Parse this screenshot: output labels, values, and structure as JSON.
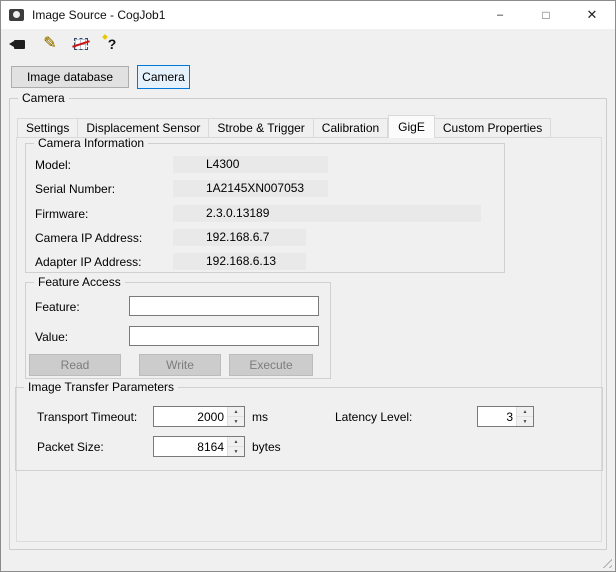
{
  "window": {
    "title": "Image Source - CogJob1",
    "controls": {
      "minimize": "–",
      "maximize": "□",
      "close": "✕"
    }
  },
  "toolbar": {
    "icons": [
      {
        "name": "camera-icon"
      },
      {
        "name": "pencil-setup-icon"
      },
      {
        "name": "live-display-grid-icon"
      },
      {
        "name": "help-icon",
        "glyph": "?"
      }
    ]
  },
  "source_buttons": {
    "image_database": "Image database",
    "camera": "Camera"
  },
  "camera_group": {
    "label": "Camera"
  },
  "tabs": [
    "Settings",
    "Displacement Sensor",
    "Strobe & Trigger",
    "Calibration",
    "GigE",
    "Custom Properties"
  ],
  "camera_information": {
    "label": "Camera Information",
    "fields": [
      {
        "label": "Model:",
        "value": "L4300"
      },
      {
        "label": "Serial Number:",
        "value": "1A2145XN007053"
      },
      {
        "label": "Firmware:",
        "value": "2.3.0.13189"
      },
      {
        "label": "Camera IP Address:",
        "value": "192.168.6.7"
      },
      {
        "label": "Adapter IP Address:",
        "value": "192.168.6.13"
      }
    ]
  },
  "feature_access": {
    "label": "Feature Access",
    "feature_label": "Feature:",
    "value_label": "Value:",
    "feature_input_value": "",
    "value_input_value": "",
    "buttons": [
      "Read",
      "Write",
      "Execute"
    ]
  },
  "image_transfer": {
    "label": "Image Transfer Parameters",
    "transport_timeout_label": "Transport Timeout:",
    "transport_timeout_value": "2000",
    "transport_timeout_unit": "ms",
    "latency_label": "Latency Level:",
    "latency_value": "3",
    "packet_size_label": "Packet Size:",
    "packet_size_value": "8164",
    "packet_size_unit": "bytes"
  }
}
